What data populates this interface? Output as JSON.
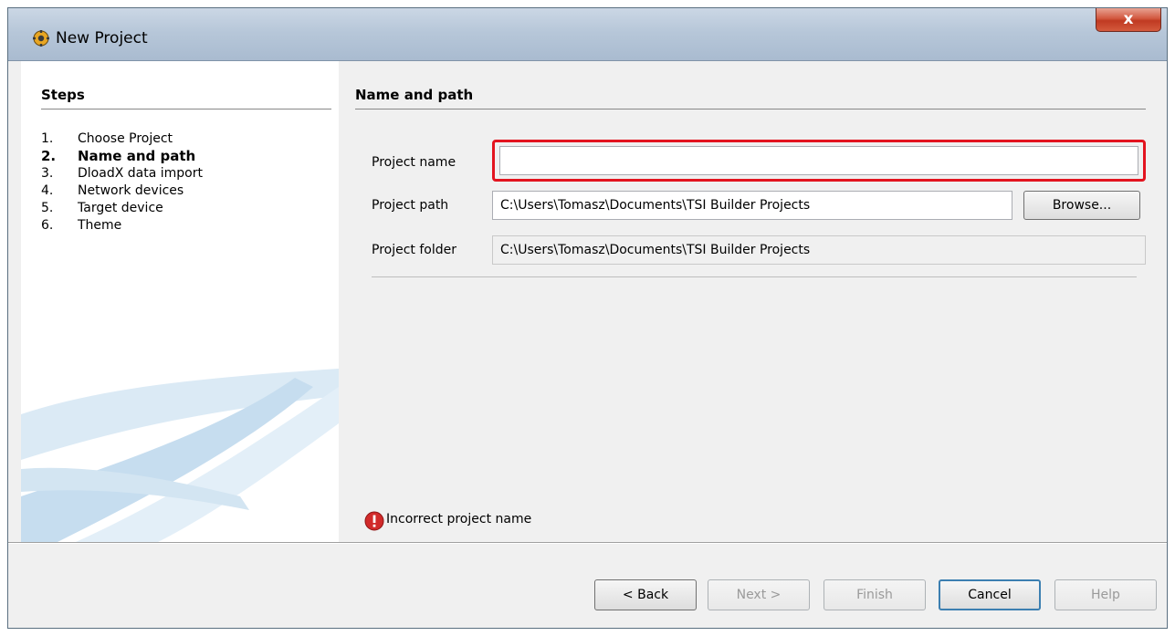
{
  "window": {
    "title": "New Project",
    "close_label": "x"
  },
  "sidebar": {
    "title": "Steps",
    "steps": [
      {
        "num": "1.",
        "label": "Choose Project"
      },
      {
        "num": "2.",
        "label": "Name and path"
      },
      {
        "num": "3.",
        "label": "DloadX data import"
      },
      {
        "num": "4.",
        "label": "Network devices"
      },
      {
        "num": "5.",
        "label": "Target device"
      },
      {
        "num": "6.",
        "label": "Theme"
      }
    ],
    "active_step": 2
  },
  "main": {
    "title": "Name and path",
    "project_name": {
      "label": "Project name",
      "value": ""
    },
    "project_path": {
      "label": "Project path",
      "value": "C:\\Users\\Tomasz\\Documents\\TSI Builder Projects"
    },
    "browse_label": "Browse...",
    "project_folder": {
      "label": "Project folder",
      "value": "C:\\Users\\Tomasz\\Documents\\TSI Builder Projects"
    },
    "error_message": "Incorrect project name"
  },
  "buttons": {
    "back": "< Back",
    "next": "Next >",
    "finish": "Finish",
    "cancel": "Cancel",
    "help": "Help"
  },
  "colors": {
    "highlight": "#e3141f",
    "error": "#cc1f1f"
  }
}
